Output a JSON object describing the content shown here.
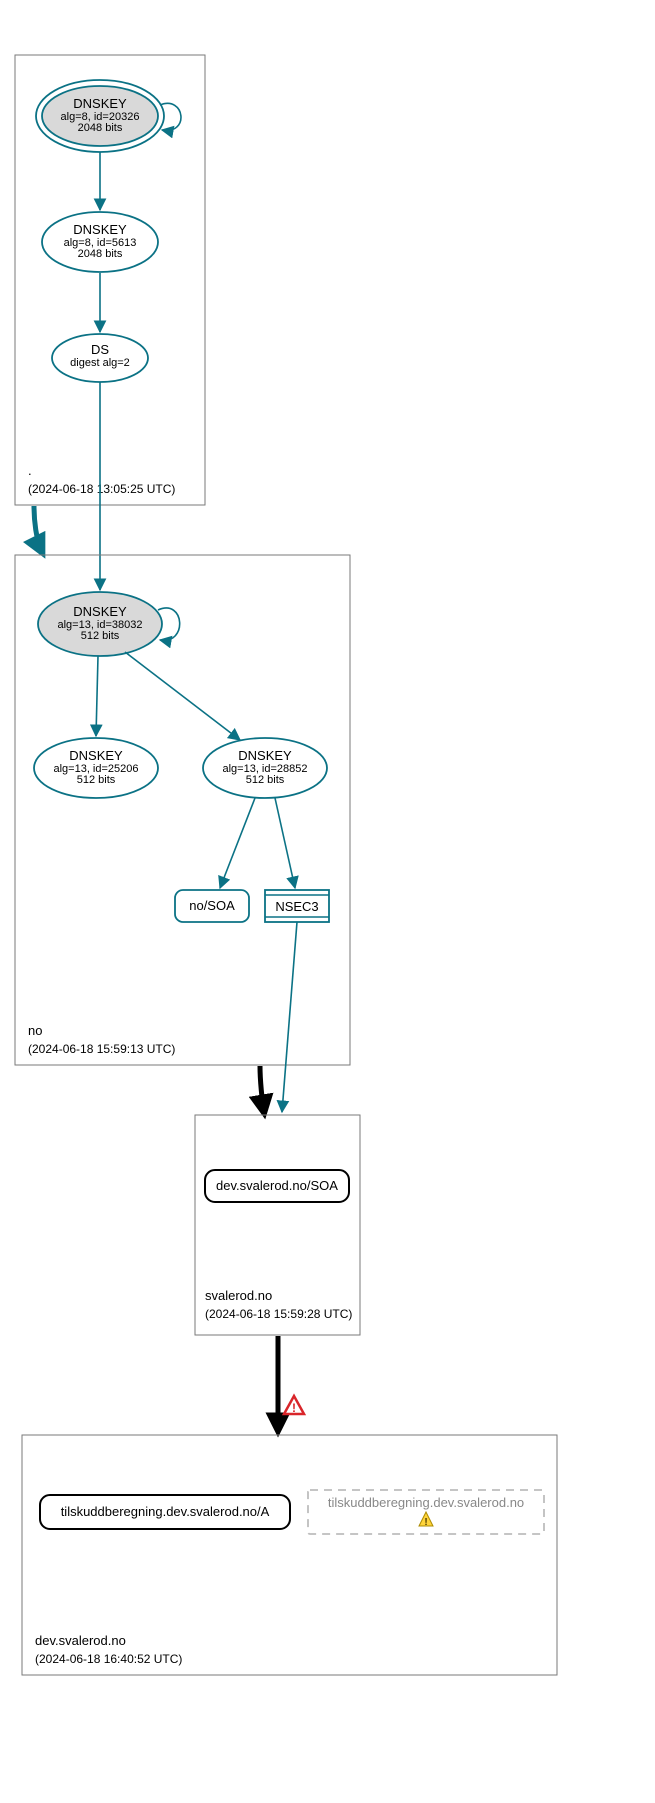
{
  "zones": {
    "root": {
      "label": ".",
      "timestamp": "(2024-06-18 13:05:25 UTC)",
      "dnskey_ksk": {
        "title": "DNSKEY",
        "line1": "alg=8, id=20326",
        "line2": "2048 bits"
      },
      "dnskey_zsk": {
        "title": "DNSKEY",
        "line1": "alg=8, id=5613",
        "line2": "2048 bits"
      },
      "ds": {
        "title": "DS",
        "line1": "digest alg=2"
      }
    },
    "no": {
      "label": "no",
      "timestamp": "(2024-06-18 15:59:13 UTC)",
      "dnskey_ksk": {
        "title": "DNSKEY",
        "line1": "alg=13, id=38032",
        "line2": "512 bits"
      },
      "dnskey_zsk1": {
        "title": "DNSKEY",
        "line1": "alg=13, id=25206",
        "line2": "512 bits"
      },
      "dnskey_zsk2": {
        "title": "DNSKEY",
        "line1": "alg=13, id=28852",
        "line2": "512 bits"
      },
      "soa": {
        "label": "no/SOA"
      },
      "nsec3": {
        "label": "NSEC3"
      }
    },
    "svalerod": {
      "label": "svalerod.no",
      "timestamp": "(2024-06-18 15:59:28 UTC)",
      "soa": {
        "label": "dev.svalerod.no/SOA"
      }
    },
    "dev": {
      "label": "dev.svalerod.no",
      "timestamp": "(2024-06-18 16:40:52 UTC)",
      "a": {
        "label": "tilskuddberegning.dev.svalerod.no/A"
      },
      "missing": {
        "label": "tilskuddberegning.dev.svalerod.no"
      }
    }
  }
}
